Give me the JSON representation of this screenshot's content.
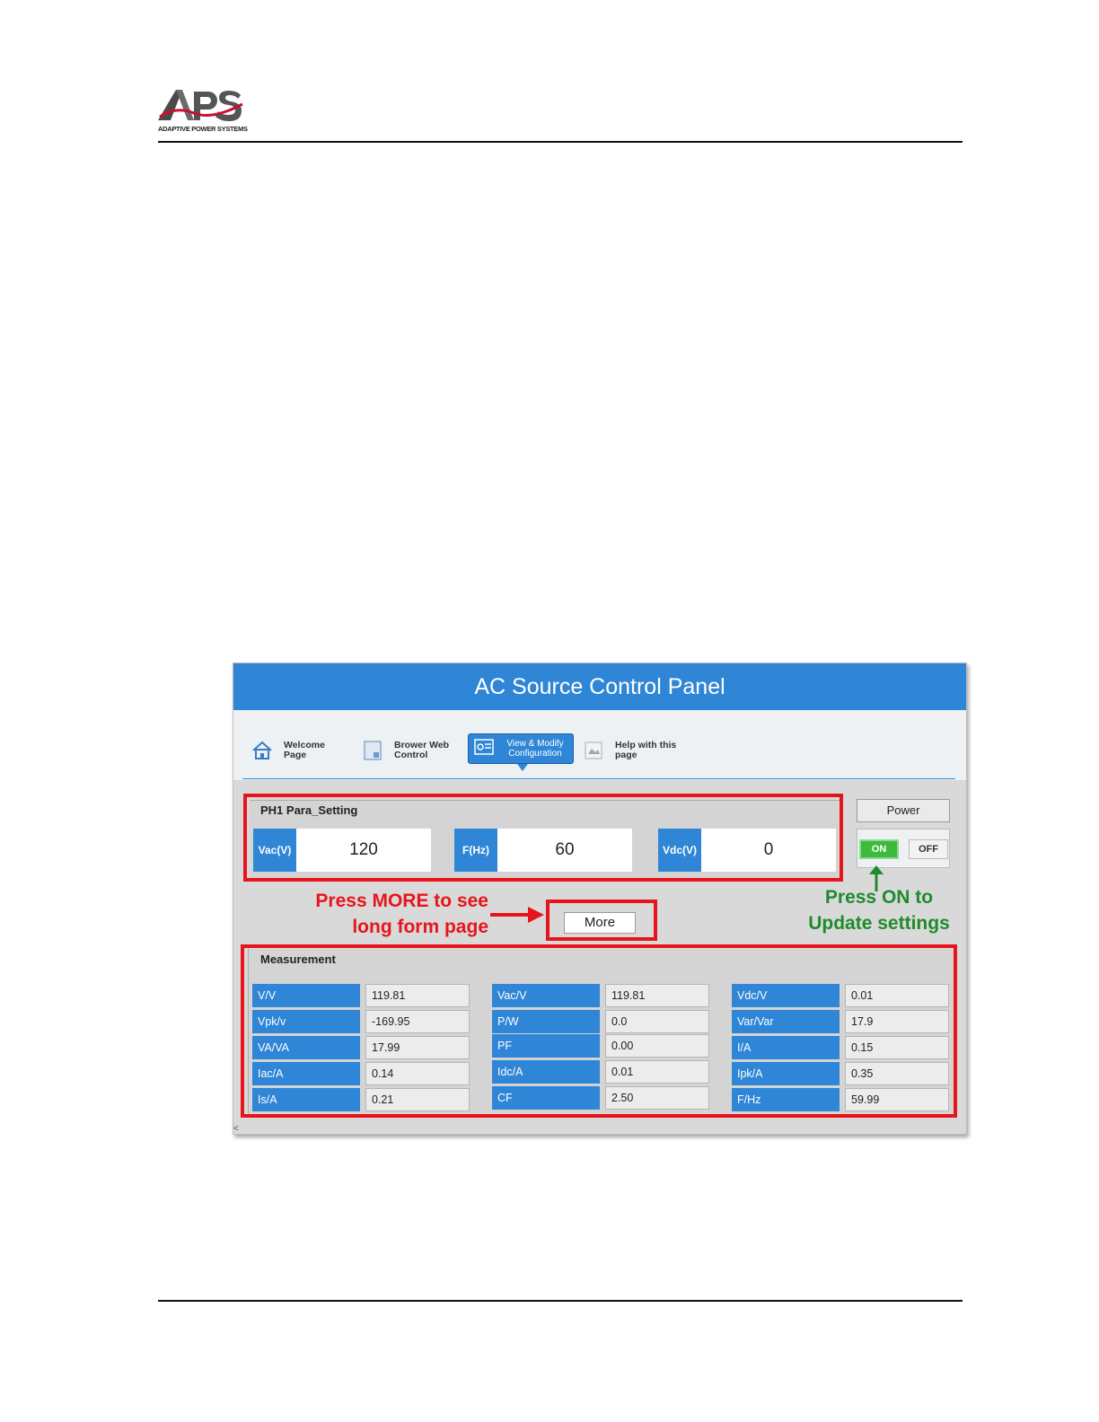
{
  "header": {
    "logo_text": "APS",
    "logo_subtitle": "ADAPTIVE POWER SYSTEMS"
  },
  "panel": {
    "title": "AC Source Control Panel",
    "nav": [
      {
        "label": "Welcome\nPage",
        "icon": "home-icon"
      },
      {
        "label": "Brower Web\nControl",
        "icon": "document-icon"
      },
      {
        "label": "View & Modify\nConfiguration",
        "icon": "config-icon",
        "active": true
      },
      {
        "label": "Help with this\npage",
        "icon": "broken-image-icon"
      }
    ],
    "ph1": {
      "title": "PH1 Para_Setting",
      "fields": [
        {
          "label": "Vac(V)",
          "value": "120"
        },
        {
          "label": "F(Hz)",
          "value": "60"
        },
        {
          "label": "Vdc(V)",
          "value": "0"
        }
      ]
    },
    "power": {
      "label": "Power",
      "on_label": "ON",
      "off_label": "OFF"
    },
    "more_label": "More",
    "measurement": {
      "title": "Measurement",
      "columns": [
        [
          {
            "label": "V/V",
            "value": "119.81"
          },
          {
            "label": "Vpk/v",
            "value": "-169.95"
          },
          {
            "label": "VA/VA",
            "value": "17.99"
          },
          {
            "label": "Iac/A",
            "value": "0.14"
          },
          {
            "label": "Is/A",
            "value": "0.21"
          }
        ],
        [
          {
            "label": "Vac/V",
            "value": "119.81"
          },
          {
            "label": "P/W",
            "value": "0.0"
          },
          {
            "label": "PF",
            "value": "0.00"
          },
          {
            "label": "Idc/A",
            "value": "0.01"
          },
          {
            "label": "CF",
            "value": "2.50"
          }
        ],
        [
          {
            "label": "Vdc/V",
            "value": "0.01"
          },
          {
            "label": "Var/Var",
            "value": "17.9"
          },
          {
            "label": "I/A",
            "value": "0.15"
          },
          {
            "label": "Ipk/A",
            "value": "0.35"
          },
          {
            "label": "F/Hz",
            "value": "59.99"
          }
        ]
      ]
    },
    "scroll_marker": "<"
  },
  "annotations": {
    "more_note": "Press MORE to see\nlong form page",
    "on_note": "Press ON to\nUpdate settings"
  },
  "colors": {
    "accent": "#2f86d6",
    "annotation_red": "#e8141b",
    "annotation_green": "#1e8c2c",
    "on_button": "#3cba3c"
  }
}
